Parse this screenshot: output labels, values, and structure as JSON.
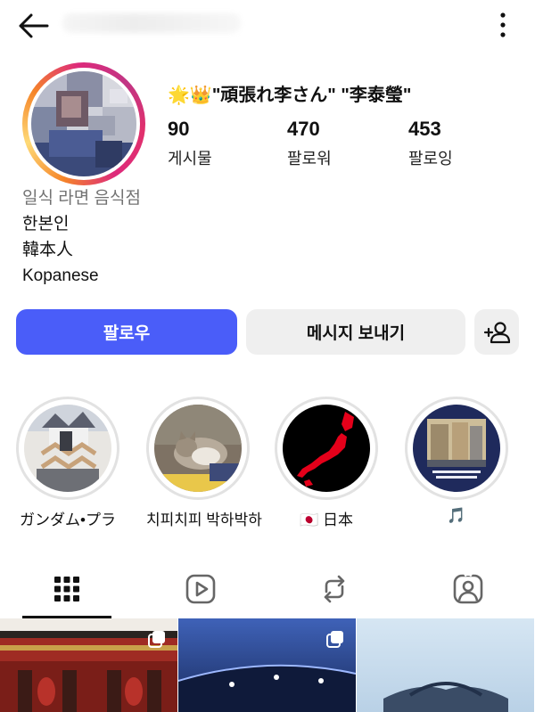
{
  "profile": {
    "display_name_emoji": "🌟👑",
    "display_name": "\"頑張れ李さん\" \"李泰瑩\"",
    "stats": [
      {
        "value": "90",
        "label": "게시물"
      },
      {
        "value": "470",
        "label": "팔로워"
      },
      {
        "value": "453",
        "label": "팔로잉"
      }
    ],
    "bio": {
      "category": "일식 라면 음식점",
      "lines": [
        "한본인",
        "韓本人",
        "Kopanese"
      ]
    }
  },
  "actions": {
    "follow_label": "팔로우",
    "message_label": "메시지 보내기",
    "suggest_icon": "add-person-icon"
  },
  "highlights": [
    {
      "label": "ガンダム•プラ"
    },
    {
      "label": "치피치피 박하박하"
    },
    {
      "flag": "🇯🇵",
      "label": "日本"
    },
    {
      "label": "🎵"
    }
  ],
  "tabs": [
    {
      "icon": "grid-icon",
      "active": true
    },
    {
      "icon": "reels-icon",
      "active": false
    },
    {
      "icon": "reposts-icon",
      "active": false
    },
    {
      "icon": "tagged-icon",
      "active": false
    }
  ],
  "colors": {
    "follow_button": "#4a5df9",
    "secondary_button": "#efefef",
    "story_ring_gradient": [
      "#f58529",
      "#feda77",
      "#dd2a7b",
      "#c13584"
    ]
  }
}
